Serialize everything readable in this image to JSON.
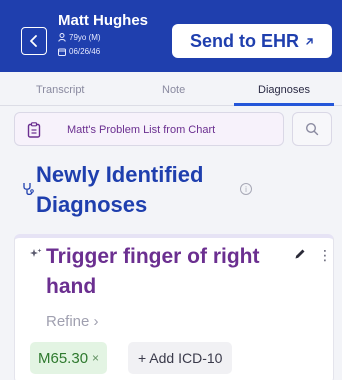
{
  "header": {
    "patient_name": "Matt Hughes",
    "patient_age_sex": "79yo (M)",
    "patient_dob": "06/26/46",
    "send_button_label": "Send to EHR",
    "colors": {
      "brand": "#1f3fae"
    }
  },
  "tabs": [
    {
      "label": "Transcript",
      "active": false
    },
    {
      "label": "Note",
      "active": false
    },
    {
      "label": "Diagnoses",
      "active": true
    }
  ],
  "problem_list": {
    "label": "Matt's Problem List from Chart"
  },
  "section": {
    "title": "Newly Identified Diagnoses"
  },
  "diagnosis_card": {
    "title": "Trigger finger of right hand",
    "refine_label": "Refine ›",
    "code": "M65.30",
    "code_remove": "×",
    "add_code_label": "+ Add ICD-10"
  }
}
